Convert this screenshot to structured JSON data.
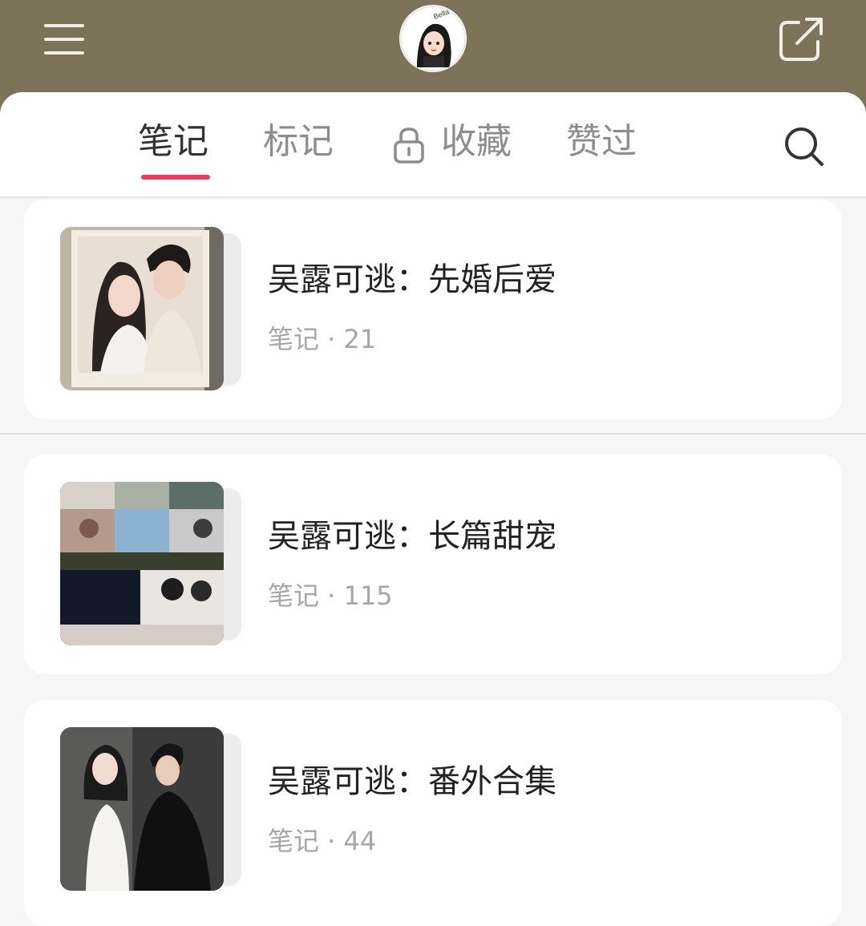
{
  "header": {
    "avatar_text": "Bella"
  },
  "tabs": [
    {
      "label": "笔记",
      "active": true
    },
    {
      "label": "标记",
      "active": false
    },
    {
      "label": "收藏",
      "active": false,
      "locked": true
    },
    {
      "label": "赞过",
      "active": false
    }
  ],
  "collections": [
    {
      "title": "吴露可逃：先婚后爱",
      "meta": "笔记 · 21"
    },
    {
      "title": "吴露可逃：长篇甜宠",
      "meta": "笔记 · 115"
    },
    {
      "title": "吴露可逃：番外合集",
      "meta": "笔记 · 44"
    }
  ],
  "colors": {
    "header_bg": "#7d7359",
    "accent": "#ef3b55"
  },
  "icons": [
    "menu-icon",
    "share-icon",
    "lock-icon",
    "search-icon"
  ]
}
